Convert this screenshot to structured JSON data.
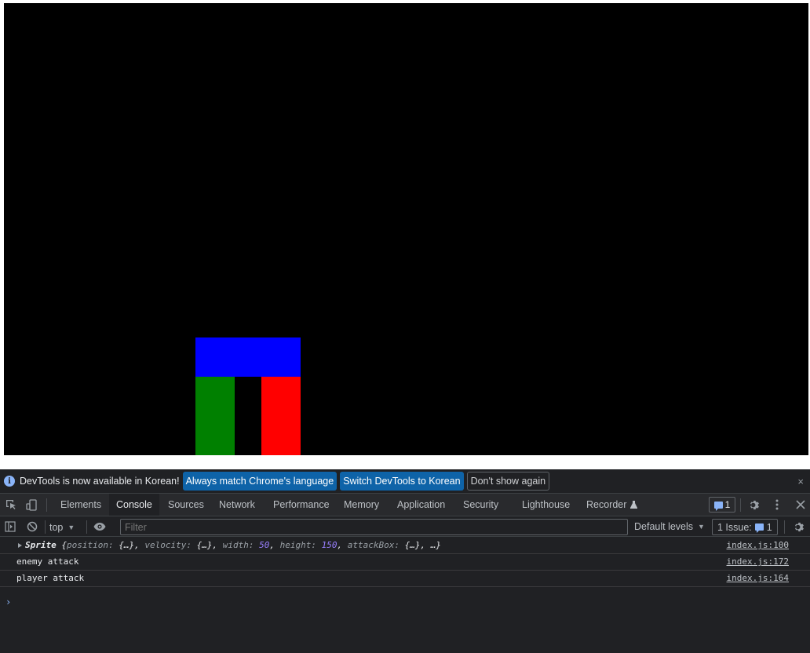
{
  "page": {
    "canvas_color": "#000000",
    "sprites": [
      {
        "name": "enemy-attack-box",
        "color": "#0000ff"
      },
      {
        "name": "player",
        "color": "#008000"
      },
      {
        "name": "enemy",
        "color": "#ff0000"
      }
    ]
  },
  "devtools": {
    "infobar": {
      "message": "DevTools is now available in Korean!",
      "btn_match": "Always match Chrome's language",
      "btn_switch": "Switch DevTools to Korean",
      "btn_dismiss": "Don't show again",
      "close": "×"
    },
    "tabs": [
      "Elements",
      "Console",
      "Sources",
      "Network",
      "Performance",
      "Memory",
      "Application",
      "Security",
      "Lighthouse",
      "Recorder"
    ],
    "active_tab": "Console",
    "issue_badge_count": "1",
    "console_toolbar": {
      "context": "top",
      "filter_placeholder": "Filter",
      "levels": "Default levels",
      "issues_label": "1 Issue:",
      "issues_count": "1"
    },
    "logs": [
      {
        "type": "object",
        "class_name": "Sprite",
        "open": "{",
        "pos_key": "position",
        "pos_val": "{…}",
        "vel_key": "velocity",
        "vel_val": "{…}",
        "w_key": "width",
        "w_val": "50",
        "h_key": "height",
        "h_val": "150",
        "ab_key": "attackBox",
        "ab_val": "{…}",
        "close": "…}",
        "source": "index.js:100"
      },
      {
        "type": "text",
        "text": "enemy attack",
        "source": "index.js:172"
      },
      {
        "type": "text",
        "text": "player attack",
        "source": "index.js:164"
      }
    ],
    "prompt": "›"
  }
}
